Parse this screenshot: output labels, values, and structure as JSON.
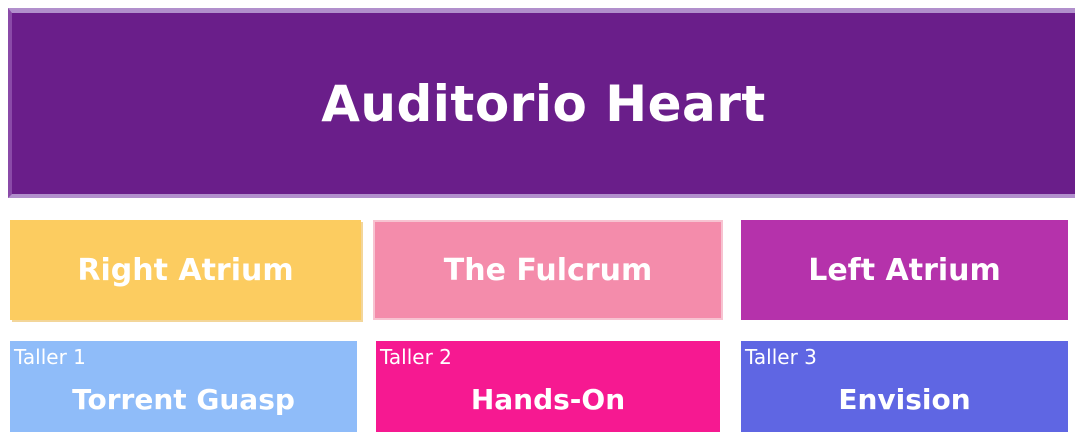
{
  "header": {
    "title": "Auditorio Heart",
    "color": "#6a1e8a"
  },
  "rooms": [
    {
      "label": "Right Atrium",
      "color": "#fccc60"
    },
    {
      "label": "The Fulcrum",
      "color": "#f48cab"
    },
    {
      "label": "Left Atrium",
      "color": "#b532ab"
    }
  ],
  "talleres": [
    {
      "number_label": "Taller 1",
      "name": "Torrent Guasp",
      "color": "#8fbcf9"
    },
    {
      "number_label": "Taller 2",
      "name": "Hands-On",
      "color": "#f61991"
    },
    {
      "number_label": "Taller 3",
      "name": "Envision",
      "color": "#5f66e3"
    }
  ]
}
